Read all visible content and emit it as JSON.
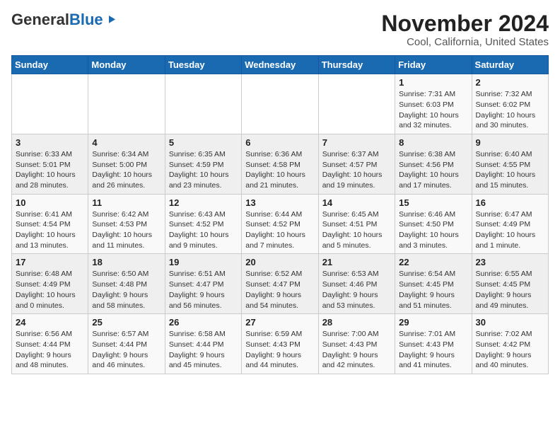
{
  "header": {
    "logo_general": "General",
    "logo_blue": "Blue",
    "title": "November 2024",
    "subtitle": "Cool, California, United States"
  },
  "weekdays": [
    "Sunday",
    "Monday",
    "Tuesday",
    "Wednesday",
    "Thursday",
    "Friday",
    "Saturday"
  ],
  "weeks": [
    [
      {
        "day": "",
        "info": ""
      },
      {
        "day": "",
        "info": ""
      },
      {
        "day": "",
        "info": ""
      },
      {
        "day": "",
        "info": ""
      },
      {
        "day": "",
        "info": ""
      },
      {
        "day": "1",
        "info": "Sunrise: 7:31 AM\nSunset: 6:03 PM\nDaylight: 10 hours\nand 32 minutes."
      },
      {
        "day": "2",
        "info": "Sunrise: 7:32 AM\nSunset: 6:02 PM\nDaylight: 10 hours\nand 30 minutes."
      }
    ],
    [
      {
        "day": "3",
        "info": "Sunrise: 6:33 AM\nSunset: 5:01 PM\nDaylight: 10 hours\nand 28 minutes."
      },
      {
        "day": "4",
        "info": "Sunrise: 6:34 AM\nSunset: 5:00 PM\nDaylight: 10 hours\nand 26 minutes."
      },
      {
        "day": "5",
        "info": "Sunrise: 6:35 AM\nSunset: 4:59 PM\nDaylight: 10 hours\nand 23 minutes."
      },
      {
        "day": "6",
        "info": "Sunrise: 6:36 AM\nSunset: 4:58 PM\nDaylight: 10 hours\nand 21 minutes."
      },
      {
        "day": "7",
        "info": "Sunrise: 6:37 AM\nSunset: 4:57 PM\nDaylight: 10 hours\nand 19 minutes."
      },
      {
        "day": "8",
        "info": "Sunrise: 6:38 AM\nSunset: 4:56 PM\nDaylight: 10 hours\nand 17 minutes."
      },
      {
        "day": "9",
        "info": "Sunrise: 6:40 AM\nSunset: 4:55 PM\nDaylight: 10 hours\nand 15 minutes."
      }
    ],
    [
      {
        "day": "10",
        "info": "Sunrise: 6:41 AM\nSunset: 4:54 PM\nDaylight: 10 hours\nand 13 minutes."
      },
      {
        "day": "11",
        "info": "Sunrise: 6:42 AM\nSunset: 4:53 PM\nDaylight: 10 hours\nand 11 minutes."
      },
      {
        "day": "12",
        "info": "Sunrise: 6:43 AM\nSunset: 4:52 PM\nDaylight: 10 hours\nand 9 minutes."
      },
      {
        "day": "13",
        "info": "Sunrise: 6:44 AM\nSunset: 4:52 PM\nDaylight: 10 hours\nand 7 minutes."
      },
      {
        "day": "14",
        "info": "Sunrise: 6:45 AM\nSunset: 4:51 PM\nDaylight: 10 hours\nand 5 minutes."
      },
      {
        "day": "15",
        "info": "Sunrise: 6:46 AM\nSunset: 4:50 PM\nDaylight: 10 hours\nand 3 minutes."
      },
      {
        "day": "16",
        "info": "Sunrise: 6:47 AM\nSunset: 4:49 PM\nDaylight: 10 hours\nand 1 minute."
      }
    ],
    [
      {
        "day": "17",
        "info": "Sunrise: 6:48 AM\nSunset: 4:49 PM\nDaylight: 10 hours\nand 0 minutes."
      },
      {
        "day": "18",
        "info": "Sunrise: 6:50 AM\nSunset: 4:48 PM\nDaylight: 9 hours\nand 58 minutes."
      },
      {
        "day": "19",
        "info": "Sunrise: 6:51 AM\nSunset: 4:47 PM\nDaylight: 9 hours\nand 56 minutes."
      },
      {
        "day": "20",
        "info": "Sunrise: 6:52 AM\nSunset: 4:47 PM\nDaylight: 9 hours\nand 54 minutes."
      },
      {
        "day": "21",
        "info": "Sunrise: 6:53 AM\nSunset: 4:46 PM\nDaylight: 9 hours\nand 53 minutes."
      },
      {
        "day": "22",
        "info": "Sunrise: 6:54 AM\nSunset: 4:45 PM\nDaylight: 9 hours\nand 51 minutes."
      },
      {
        "day": "23",
        "info": "Sunrise: 6:55 AM\nSunset: 4:45 PM\nDaylight: 9 hours\nand 49 minutes."
      }
    ],
    [
      {
        "day": "24",
        "info": "Sunrise: 6:56 AM\nSunset: 4:44 PM\nDaylight: 9 hours\nand 48 minutes."
      },
      {
        "day": "25",
        "info": "Sunrise: 6:57 AM\nSunset: 4:44 PM\nDaylight: 9 hours\nand 46 minutes."
      },
      {
        "day": "26",
        "info": "Sunrise: 6:58 AM\nSunset: 4:44 PM\nDaylight: 9 hours\nand 45 minutes."
      },
      {
        "day": "27",
        "info": "Sunrise: 6:59 AM\nSunset: 4:43 PM\nDaylight: 9 hours\nand 44 minutes."
      },
      {
        "day": "28",
        "info": "Sunrise: 7:00 AM\nSunset: 4:43 PM\nDaylight: 9 hours\nand 42 minutes."
      },
      {
        "day": "29",
        "info": "Sunrise: 7:01 AM\nSunset: 4:43 PM\nDaylight: 9 hours\nand 41 minutes."
      },
      {
        "day": "30",
        "info": "Sunrise: 7:02 AM\nSunset: 4:42 PM\nDaylight: 9 hours\nand 40 minutes."
      }
    ]
  ]
}
